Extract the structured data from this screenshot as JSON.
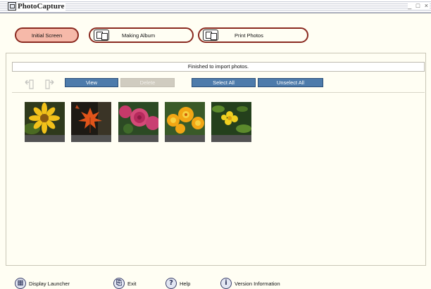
{
  "window": {
    "title": "PhotoCapture",
    "controls": "_ □ ×"
  },
  "nav": {
    "initial_screen": "Initial Screen",
    "making_album": "Making Album",
    "print_photos": "Print Photos"
  },
  "status": {
    "message": "Finished to import photos."
  },
  "toolbar": {
    "view": "View",
    "delete": "Delete",
    "select_all": "Select All",
    "unselect_all": "Unselect All"
  },
  "thumbnails": [
    {
      "subject": "yellow-flower"
    },
    {
      "subject": "orange-maple-leaves"
    },
    {
      "subject": "pink-roses"
    },
    {
      "subject": "yellow-orange-flowers"
    },
    {
      "subject": "yellow-flower-green-leaves"
    }
  ],
  "footer": {
    "display_launcher": "Display Launcher",
    "exit": "Exit",
    "help": "Help",
    "version_information": "Version Information"
  },
  "colors": {
    "background": "#fffef3",
    "active_nav": "#f6b9a9",
    "nav_border": "#8a2a20",
    "button_blue": "#4d7bab",
    "button_disabled": "#d0ccc0"
  }
}
